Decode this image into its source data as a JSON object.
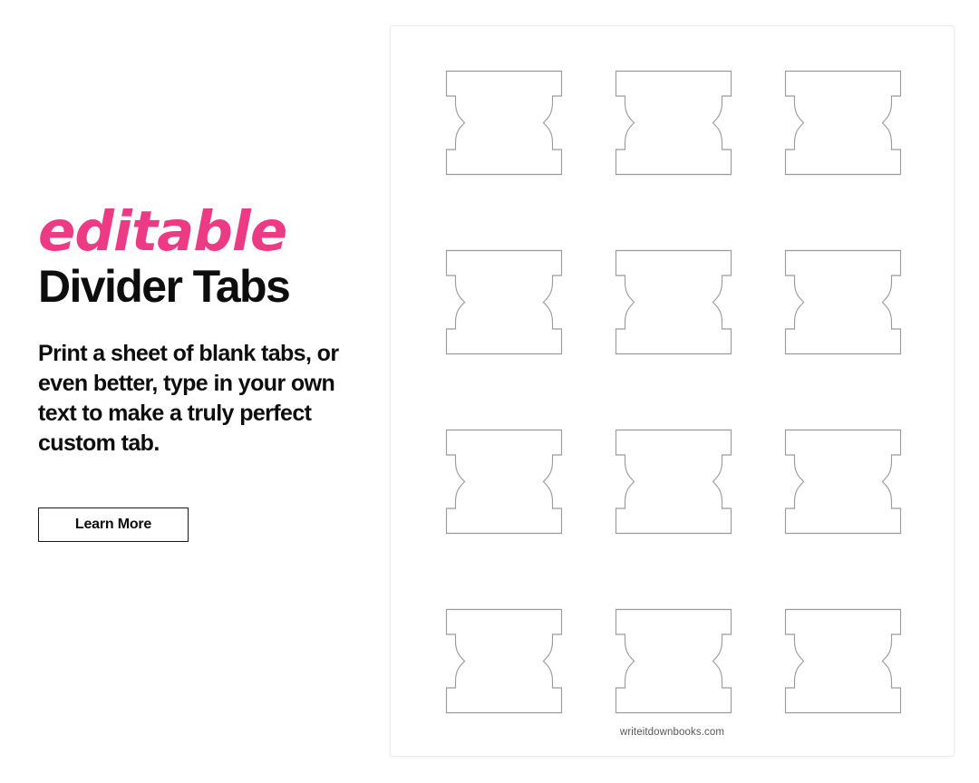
{
  "promo": {
    "eyebrow": "editable",
    "headline": "Divider Tabs",
    "body": "Print a sheet of blank tabs, or even better, type in your own text to make a truly perfect custom tab.",
    "cta_label": "Learn More",
    "accent_color": "#EC3B84",
    "text_color": "#0D0D0D"
  },
  "sheet": {
    "footer_url": "writeitdownbooks.com",
    "columns": 3,
    "rows": 4,
    "tab_count": 12,
    "tab_outline_color": "#9B9B9B",
    "tab_fill_color": "#FFFFFF",
    "tabs": [
      {
        "label": ""
      },
      {
        "label": ""
      },
      {
        "label": ""
      },
      {
        "label": ""
      },
      {
        "label": ""
      },
      {
        "label": ""
      },
      {
        "label": ""
      },
      {
        "label": ""
      },
      {
        "label": ""
      },
      {
        "label": ""
      },
      {
        "label": ""
      },
      {
        "label": ""
      }
    ]
  }
}
